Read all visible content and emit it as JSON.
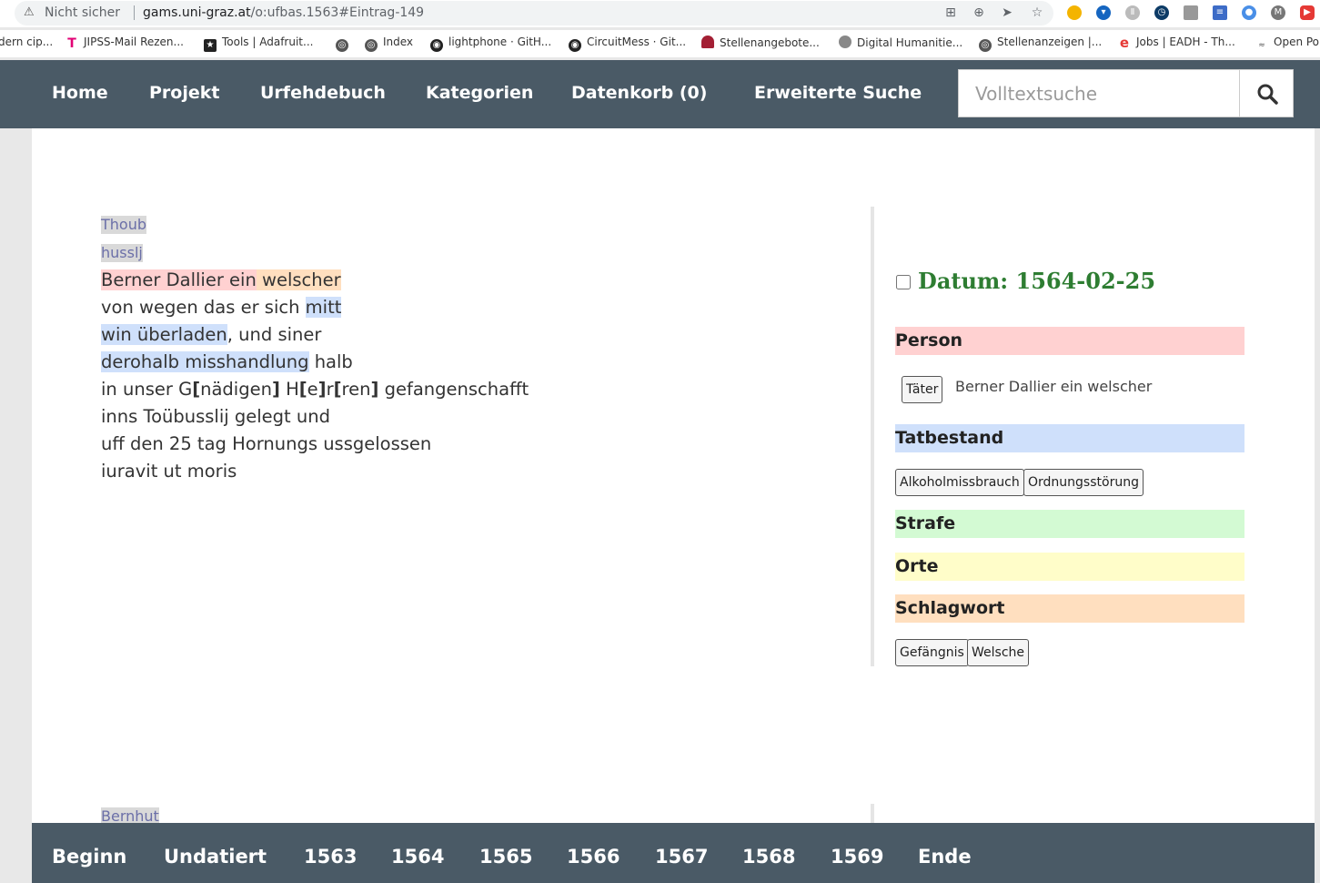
{
  "browser": {
    "security_label": "Nicht sicher",
    "url_host": "gams.uni-graz.at",
    "url_path": "/o:ufbas.1563#Eintrag-149",
    "bookmarks": [
      "dern cip...",
      "JIPSS-Mail Rezen...",
      "Tools | Adafruit...",
      "",
      "Index",
      "lightphone · GitH...",
      "CircuitMess · Git...",
      "Stellenangebote...",
      "Digital Humanitie...",
      "Stellenanzeigen |...",
      "Jobs | EADH - Th...",
      "Open Po"
    ]
  },
  "nav": {
    "items": [
      "Home",
      "Projekt",
      "Urfehdebuch",
      "Kategorien",
      "Datenkorb (0)",
      "Erweiterte Suche"
    ],
    "search_placeholder": "Volltextsuche"
  },
  "entry": {
    "margin_notes": [
      "Thoub",
      "husslj"
    ],
    "line1": {
      "person": "Berner Dallier ein",
      "keyword": "welscher"
    },
    "line2": {
      "text": "von wegen das er sich",
      "act": "mitt"
    },
    "line3": {
      "act": "win überladen",
      "text": ", und siner"
    },
    "line4": {
      "act": "derohalb misshandlung",
      "text": "halb"
    },
    "line5": {
      "a": "in unser G",
      "b": "[",
      "c": "nädigen",
      "d": "]",
      "e": " H",
      "f": "[",
      "g": "e",
      "h": "]",
      "i": "r",
      "j": "[",
      "k": "ren",
      "l": "]",
      "m": " gefangenschafft"
    },
    "line6": "inns Toübusslij gelegt und",
    "line7": "uff den 25 tag Hornungs ussgelossen",
    "line8": "iuravit ut moris",
    "next_note": "Bernhut"
  },
  "side": {
    "date_label": "Datum: 1564-02-25",
    "person_heading": "Person",
    "person_role": "Täter",
    "person_name": "Berner Dallier ein welscher",
    "tatbestand_heading": "Tatbestand",
    "tatbestand_tags": [
      "Alkoholmissbrauch",
      "Ordnungsstörung"
    ],
    "strafe_heading": "Strafe",
    "orte_heading": "Orte",
    "schlagwort_heading": "Schlagwort",
    "schlagwort_tags": [
      "Gefängnis",
      "Welsche"
    ],
    "colors": {
      "person": "#ffd1d1",
      "tatbestand": "#cfe0fb",
      "strafe": "#d3fad3",
      "orte": "#fffdc9",
      "schlagwort": "#ffdfbf",
      "date": "#2e7d32"
    }
  },
  "footer": {
    "items": [
      "Beginn",
      "Undatiert",
      "1563",
      "1564",
      "1565",
      "1566",
      "1567",
      "1568",
      "1569",
      "Ende"
    ]
  }
}
